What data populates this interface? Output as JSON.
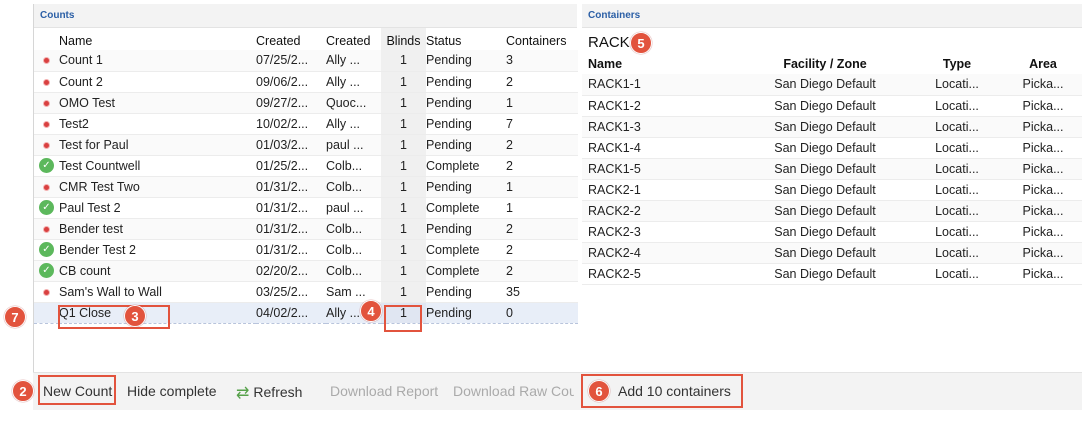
{
  "counts_panel": {
    "title": "Counts",
    "columns": [
      "Name",
      "Created",
      "Created",
      "Blinds",
      "Status",
      "Containers"
    ],
    "rows": [
      {
        "icon": "error",
        "name": "Count 1",
        "created_date": "07/25/2...",
        "created_by": "Ally ...",
        "blinds": "1",
        "status": "Pending",
        "containers": "3"
      },
      {
        "icon": "error",
        "name": "Count 2",
        "created_date": "09/06/2...",
        "created_by": "Ally ...",
        "blinds": "1",
        "status": "Pending",
        "containers": "2"
      },
      {
        "icon": "error",
        "name": "OMO Test",
        "created_date": "09/27/2...",
        "created_by": "Quoc...",
        "blinds": "1",
        "status": "Pending",
        "containers": "1"
      },
      {
        "icon": "error",
        "name": "Test2",
        "created_date": "10/02/2...",
        "created_by": "Ally ...",
        "blinds": "1",
        "status": "Pending",
        "containers": "7"
      },
      {
        "icon": "error",
        "name": "Test for Paul",
        "created_date": "01/03/2...",
        "created_by": "paul ...",
        "blinds": "1",
        "status": "Pending",
        "containers": "2"
      },
      {
        "icon": "check",
        "name": "Test Countwell",
        "created_date": "01/25/2...",
        "created_by": "Colb...",
        "blinds": "1",
        "status": "Complete",
        "containers": "2"
      },
      {
        "icon": "error",
        "name": "CMR Test Two",
        "created_date": "01/31/2...",
        "created_by": "Colb...",
        "blinds": "1",
        "status": "Pending",
        "containers": "1"
      },
      {
        "icon": "check",
        "name": "Paul Test 2",
        "created_date": "01/31/2...",
        "created_by": "paul ...",
        "blinds": "1",
        "status": "Complete",
        "containers": "1"
      },
      {
        "icon": "error",
        "name": "Bender test",
        "created_date": "01/31/2...",
        "created_by": "Colb...",
        "blinds": "1",
        "status": "Pending",
        "containers": "2"
      },
      {
        "icon": "check",
        "name": "Bender Test 2",
        "created_date": "01/31/2...",
        "created_by": "Colb...",
        "blinds": "1",
        "status": "Complete",
        "containers": "2"
      },
      {
        "icon": "check",
        "name": "CB count",
        "created_date": "02/20/2...",
        "created_by": "Colb...",
        "blinds": "1",
        "status": "Complete",
        "containers": "2"
      },
      {
        "icon": "error",
        "name": "Sam's Wall to Wall",
        "created_date": "03/25/2...",
        "created_by": "Sam ...",
        "blinds": "1",
        "status": "Pending",
        "containers": "35"
      }
    ],
    "new_row": {
      "name": "Q1 Close",
      "created_date": "04/02/2...",
      "created_by": "Ally ...",
      "blinds": "1",
      "status": "Pending",
      "containers": "0"
    }
  },
  "containers_panel": {
    "title": "Containers",
    "rack_label": "RACK",
    "columns": [
      "Name",
      "Facility / Zone",
      "Type",
      "Area"
    ],
    "rows": [
      {
        "name": "RACK1-1",
        "facility": "San Diego Default",
        "type": "Locati...",
        "area": "Picka..."
      },
      {
        "name": "RACK1-2",
        "facility": "San Diego Default",
        "type": "Locati...",
        "area": "Picka..."
      },
      {
        "name": "RACK1-3",
        "facility": "San Diego Default",
        "type": "Locati...",
        "area": "Picka..."
      },
      {
        "name": "RACK1-4",
        "facility": "San Diego Default",
        "type": "Locati...",
        "area": "Picka..."
      },
      {
        "name": "RACK1-5",
        "facility": "San Diego Default",
        "type": "Locati...",
        "area": "Picka..."
      },
      {
        "name": "RACK2-1",
        "facility": "San Diego Default",
        "type": "Locati...",
        "area": "Picka..."
      },
      {
        "name": "RACK2-2",
        "facility": "San Diego Default",
        "type": "Locati...",
        "area": "Picka..."
      },
      {
        "name": "RACK2-3",
        "facility": "San Diego Default",
        "type": "Locati...",
        "area": "Picka..."
      },
      {
        "name": "RACK2-4",
        "facility": "San Diego Default",
        "type": "Locati...",
        "area": "Picka..."
      },
      {
        "name": "RACK2-5",
        "facility": "San Diego Default",
        "type": "Locati...",
        "area": "Picka..."
      }
    ]
  },
  "toolbar": {
    "new_count": "New Count",
    "hide_complete": "Hide complete",
    "refresh": "Refresh",
    "download_report": "Download Report",
    "download_raw": "Download Raw Cou",
    "add_containers": "Add 10 containers"
  },
  "callouts": [
    "7",
    "2",
    "3",
    "4",
    "5",
    "6"
  ],
  "colors": {
    "accent": "#e2533d",
    "header_text": "#2b5fa6",
    "error_dot": "#d94040",
    "complete_check": "#5cb85c",
    "refresh_icon": "#56a14a"
  }
}
